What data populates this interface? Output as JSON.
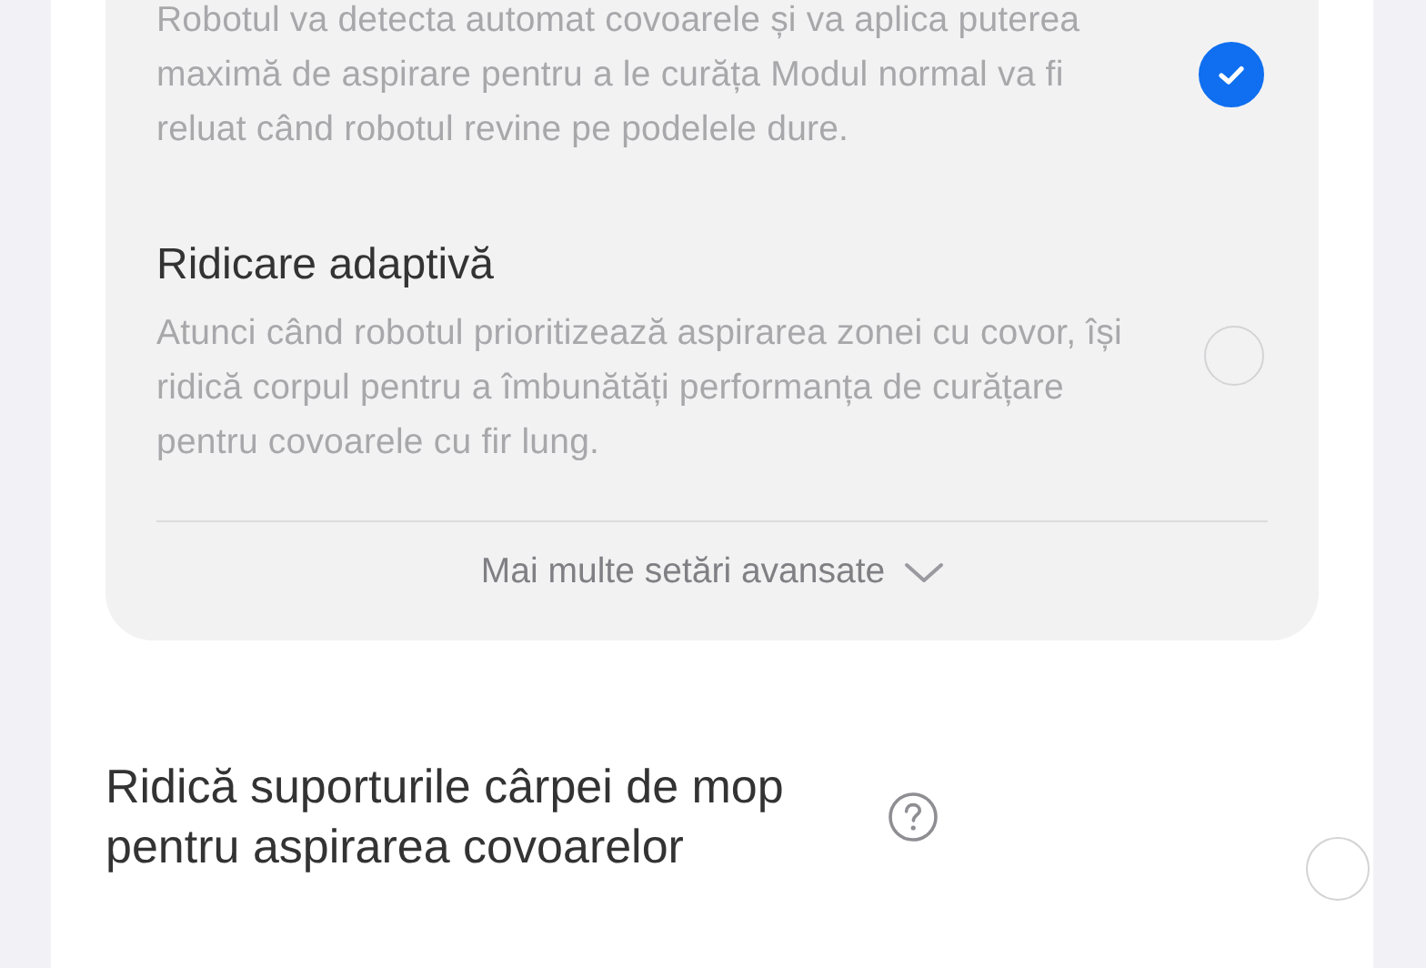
{
  "options": [
    {
      "description": "Robotul va detecta automat covoarele și va aplica puterea maximă de aspirare pentru a le curăța Modul normal va fi reluat când robotul revine pe podelele dure.",
      "selected": true
    },
    {
      "title": "Ridicare adaptivă",
      "description": "Atunci când robotul prioritizează aspirarea zonei cu covor, își ridică corpul pentru a îmbunătăți performanța de curățare pentru covoarele cu fir lung.",
      "selected": false
    }
  ],
  "more_button": {
    "label": "Mai multe setări avansate"
  },
  "setting": {
    "title": "Ridică suporturile cârpei de mop pentru aspirarea covoarelor",
    "selected": false
  }
}
